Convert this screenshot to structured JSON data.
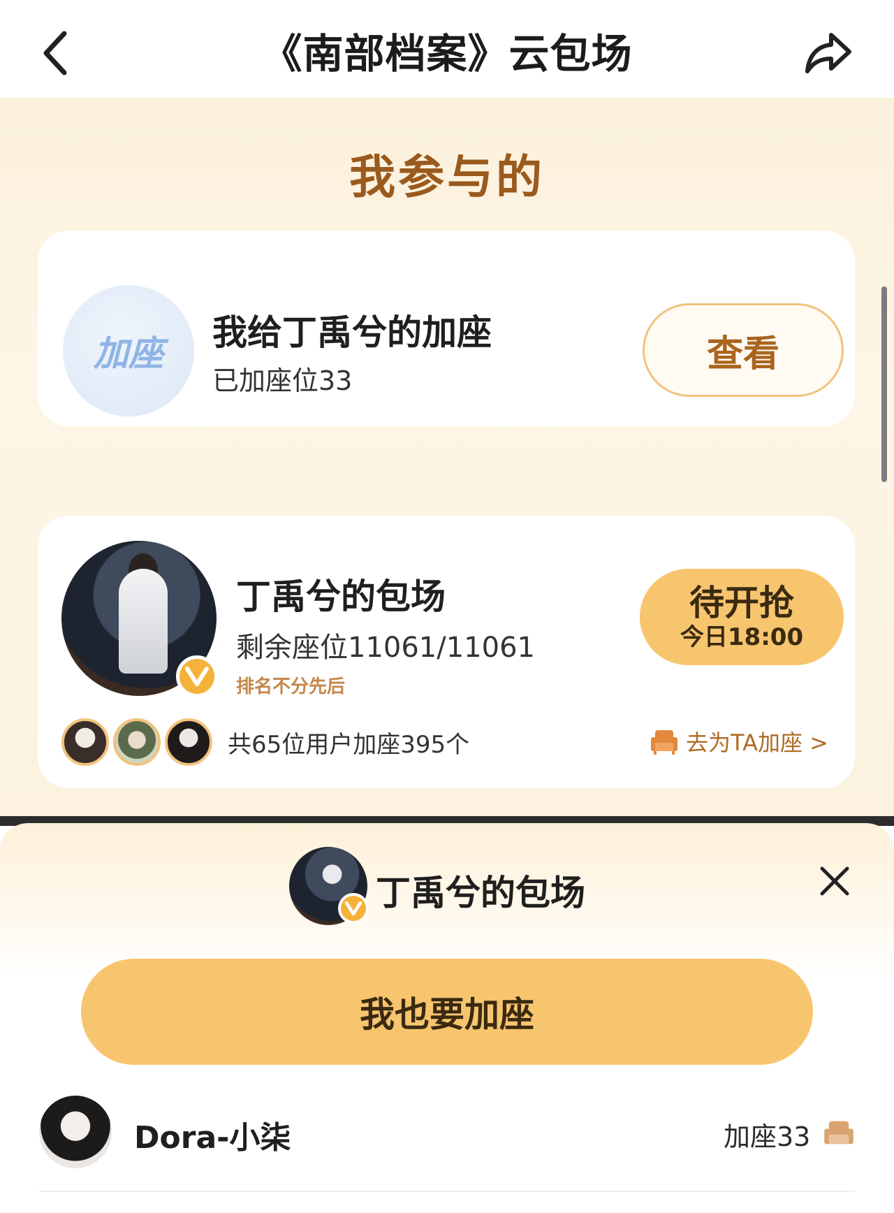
{
  "header": {
    "title": "《南部档案》云包场"
  },
  "section": {
    "title": "我参与的"
  },
  "my_seat_card": {
    "badge_text": "加座",
    "title": "我给丁禹兮的加座",
    "subtitle": "已加座位33",
    "view_label": "查看"
  },
  "theater_card": {
    "title": "丁禹兮的包场",
    "remaining": "剩余座位11061/11061",
    "rank_note": "排名不分先后",
    "status_main": "待开抢",
    "status_time": "今日18:00",
    "join_count": "共65位用户加座395个",
    "go_add_label": "去为TA加座 >"
  },
  "sheet": {
    "title": "丁禹兮的包场",
    "join_button": "我也要加座",
    "user": {
      "name": "Dora-小柒",
      "seat_count": "加座33"
    }
  },
  "colors": {
    "accent": "#f8c56f",
    "brown_text": "#9a5a1e",
    "badge": "#f5b23a"
  }
}
